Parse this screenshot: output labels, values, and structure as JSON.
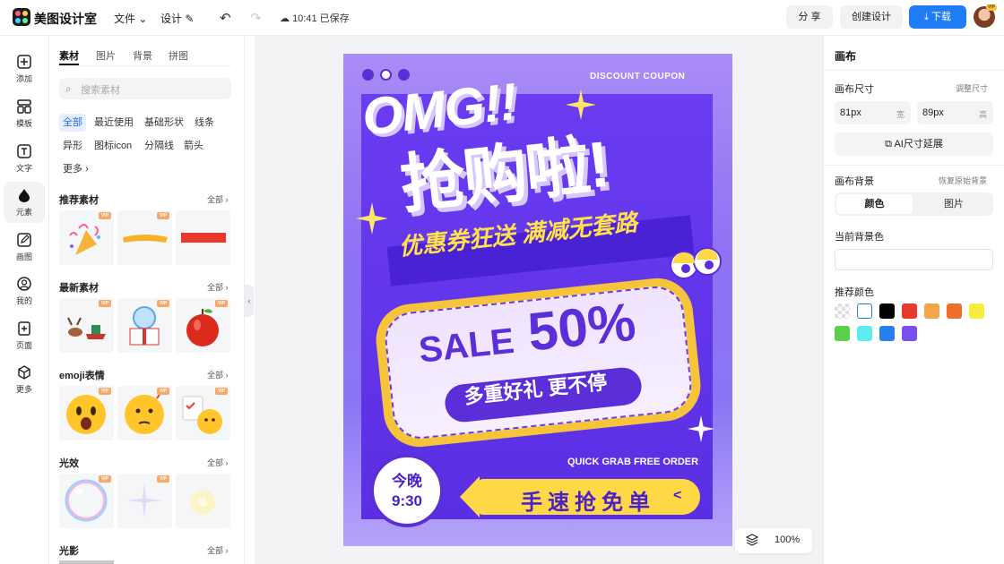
{
  "app": {
    "name": "美图设计室"
  },
  "topbar": {
    "menu_file": "文件",
    "menu_design": "设计",
    "saved_status": "10:41 已保存",
    "share": "分 享",
    "create": "创建设计",
    "download": "下载",
    "avatar_badge": "VIP"
  },
  "leftnav": {
    "items": [
      {
        "label": "添加",
        "icon": "plus-square-icon"
      },
      {
        "label": "模板",
        "icon": "template-icon"
      },
      {
        "label": "文字",
        "icon": "text-icon"
      },
      {
        "label": "元素",
        "icon": "shapes-icon"
      },
      {
        "label": "画图",
        "icon": "pen-icon"
      },
      {
        "label": "我的",
        "icon": "user-icon"
      },
      {
        "label": "页面",
        "icon": "page-add-icon"
      },
      {
        "label": "更多",
        "icon": "cube-icon"
      }
    ]
  },
  "panel": {
    "tabs": [
      "素材",
      "图片",
      "背景",
      "拼图"
    ],
    "search_placeholder": "搜索素材",
    "chips": [
      "全部",
      "最近使用",
      "基础形状",
      "线条",
      "异形",
      "图标icon",
      "分隔线",
      "箭头",
      "更多"
    ],
    "sections": [
      {
        "title": "推荐素材",
        "all": "全部"
      },
      {
        "title": "最新素材",
        "all": "全部"
      },
      {
        "title": "emoji表情",
        "all": "全部"
      },
      {
        "title": "光效",
        "all": "全部"
      },
      {
        "title": "光影",
        "all": "全部"
      }
    ],
    "vip_label": "VIP"
  },
  "poster": {
    "coupon_title": "DISCOUNT COUPON",
    "headline": "OMG!!",
    "main": "抢购啦!",
    "slogan": "优惠券狂送 满减无套路",
    "sale_word": "SALE",
    "sale_value": "50%",
    "pill": "多重好礼 更不停",
    "quick": "QUICK GRAB FREE ORDER",
    "badge_line1": "今晚",
    "badge_line2": "9:30",
    "cta": "手速抢免单",
    "cta_chevron": "<"
  },
  "zoom": {
    "value": "100%"
  },
  "rpanel": {
    "title": "画布",
    "size_label": "画布尺寸",
    "size_adjust": "调整尺寸",
    "width_value": "81px",
    "width_unit": "宽",
    "height_value": "89px",
    "height_unit": "高",
    "ai_extend": "AI尺寸延展",
    "bg_label": "画布背景",
    "bg_restore": "恢复原始背景",
    "seg_color": "颜色",
    "seg_image": "图片",
    "current_bg": "当前背景色",
    "recommended": "推荐颜色",
    "swatches": [
      "transparent",
      "#ffffff",
      "#000000",
      "#e8392a",
      "#f4a54a",
      "#ef6f2a",
      "#f5ef3a",
      "#5bd04a",
      "#5cedf2",
      "#2a7ef0",
      "#7a4ff0"
    ]
  },
  "colors": {
    "accent": "#1f7cf5",
    "poster_purple": "#5b2ed8",
    "poster_yellow": "#ffd847"
  }
}
